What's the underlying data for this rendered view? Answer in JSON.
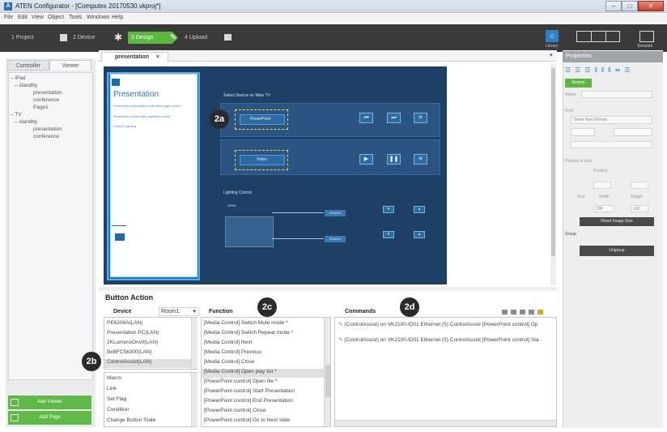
{
  "window": {
    "title": "ATEN Configurator - [Computex 20170530.vkproj*]",
    "icon_label": "A",
    "controls": [
      "–",
      "□",
      "✕"
    ]
  },
  "menu": [
    "File",
    "Edit",
    "View",
    "Object",
    "Tools",
    "Windows",
    "Help"
  ],
  "wizard": {
    "steps": [
      "1 Project",
      "2 Device",
      "3 Design",
      "4 Upload"
    ],
    "active_step": 2,
    "right_labels": [
      "Library",
      "Simulate"
    ]
  },
  "left_panel": {
    "tabs": [
      "Controller",
      "Viewer"
    ],
    "tree": [
      {
        "label": "iPad",
        "level": 0
      },
      {
        "label": "standby",
        "level": 1
      },
      {
        "label": "presentation",
        "level": 2
      },
      {
        "label": "conference",
        "level": 2
      },
      {
        "label": "Page1",
        "level": 2
      },
      {
        "label": "TV",
        "level": 0
      },
      {
        "label": "standby",
        "level": 1
      },
      {
        "label": "presentation",
        "level": 2
      },
      {
        "label": "conference",
        "level": 2
      }
    ],
    "buttons": [
      "Add Viewer",
      "Add Page"
    ]
  },
  "editor": {
    "tab_label": "presentation",
    "close_glyph": "✕",
    "canvas": {
      "card_title": "Presentation",
      "card_lines": [
        "Control the presentation with slide page control",
        "Broadcast a video with playback control",
        "Control Lighting"
      ],
      "source_heading": "Select Source on Main TV",
      "powerpoint_label": "PowerPoint",
      "video_label": "Video",
      "lighting_heading": "Lighting Control",
      "aten_label": "ATEN",
      "light_labels": [
        "Dimmer",
        "Dimmer"
      ]
    },
    "statusbar": "Button Action"
  },
  "callouts": {
    "a": "2a",
    "b": "2b",
    "c": "2c",
    "d": "2d"
  },
  "properties": {
    "title": "Properties",
    "fields": [
      "Name",
      "Font",
      "Times New Roman",
      "Position & Size",
      "Position",
      "Size",
      "Width",
      "Height",
      "200",
      "100",
      "Reset Image Size",
      "Group",
      "Ungroup"
    ],
    "green_button": "Normal"
  },
  "button_action": {
    "title": "Button Action",
    "device": {
      "header": "Device",
      "room_select": "Room1",
      "items": [
        "PE6208A(LAN)",
        "Presentation PC(LAN)",
        "2KLumensOnvif(LAN)",
        "BxBFC56300(LAN)",
        "ControlAssist(LAN)"
      ],
      "selected_index": 4,
      "extra_items": [
        "Macro",
        "Link",
        "Set Flag",
        "Condition",
        "Change Button State"
      ]
    },
    "function": {
      "header": "Function",
      "items": [
        "[Media Control] Switch Mute mode *",
        "[Media Control] Switch Repeat mode *",
        "[Media Control] Next",
        "[Media Control] Previous",
        "[Media Control] Close",
        "[Media Control] Open play list *",
        "[PowerPoint control] Open file *",
        "[PowerPoint control] Start Presentation",
        "[PowerPoint control] End Presentation",
        "[PowerPoint control] Close",
        "[PowerPoint control] Go to Next slide"
      ],
      "selected_index": 5
    },
    "commands": {
      "header": "Commands",
      "items": [
        "(ControlAssist) on VK2100-ID01 Ethernet (5) ControlAssist [PowerPoint control] Op",
        "(ControlAssist) on VK2100-ID01 Ethernet (5) ControlAssist [PowerPoint control] Sta"
      ]
    }
  }
}
